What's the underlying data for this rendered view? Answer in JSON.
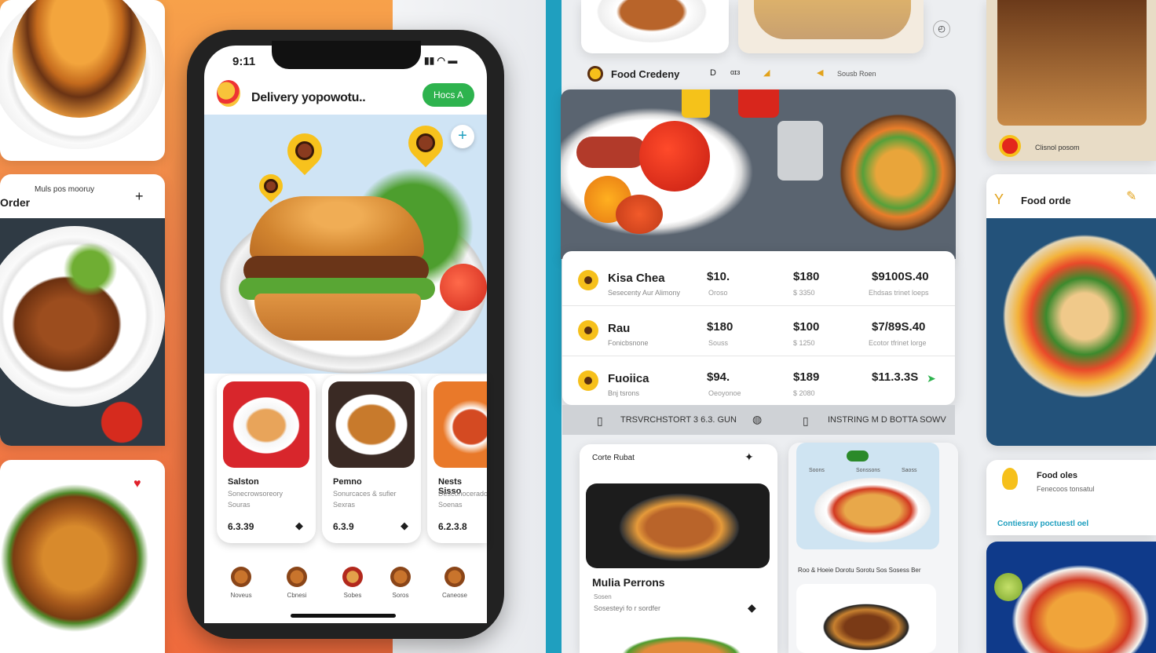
{
  "phone": {
    "status_time": "9:11",
    "app_title": "Delivery yopowotu..",
    "action_button": "Hocs A",
    "menu_cards": [
      {
        "title": "Salston",
        "line1": "Sonecrowsoreory",
        "line2": "Souras",
        "price": "6.3.39"
      },
      {
        "title": "Pemno",
        "line1": "Sonurcaces & sufier",
        "line2": "Sexras",
        "price": "6.3.9"
      },
      {
        "title": "Nests Sisso",
        "line1": "Desconocerado",
        "line2": "Soenas",
        "price": "6.2.3.8"
      }
    ],
    "tabs": [
      "Noveus",
      "Cbnesi",
      "Sobes",
      "Soros",
      "Caneose"
    ]
  },
  "left_cards": {
    "order_heading": "Order",
    "order_sub": "Muls pos mooruy"
  },
  "right_panel": {
    "header": {
      "brand": "Food Credeny",
      "item2": "D",
      "item3": "ɑɪɜ",
      "item4": "Sousb Roen"
    },
    "rows": [
      {
        "name": "Kisa Chea",
        "sub": "Sesecenty Aur Alimony",
        "c1": "$10.",
        "c1s": "Oroso",
        "c2": "$180",
        "c2s": "$ 3350",
        "c3": "$9100S.40",
        "c3s": "Ehdsas trinet loeps"
      },
      {
        "name": "Rau",
        "sub": "Fonicbsnone",
        "c1": "$180",
        "c1s": "Souss",
        "c2": "$100",
        "c2s": "$ 1250",
        "c3": "$7/89S.40",
        "c3s": "Ecotor tfrinet lorge"
      },
      {
        "name": "Fuoiica",
        "sub": "Bnj tsrons",
        "c1": "$94.",
        "c1s": "Oeoyonoe",
        "c2": "$189",
        "c2s": "$ 2080",
        "c3": "$11.3.3S",
        "c3s": ""
      }
    ],
    "footer_left": "TRSVRCHSTORT 3 6.3. GUN",
    "footer_right": "INSTRING M D BOTTA SOWV",
    "card_a_title": "Corte Rubat",
    "card_a_name": "Mulia Perrons",
    "card_a_sub1": "Sosen",
    "card_a_sub2": "Sosesteyi fo r sordfer",
    "card_b_labels": [
      "Soons",
      "Sonssons",
      "Saoss"
    ],
    "card_b_caption": "Roo & Hoeie Dorotu Sorotu Sos Sosess Ber",
    "food_orde": "Food orde",
    "food_oies": "Food oles",
    "food_oies_sub": "Fenecoos tonsatul",
    "teal_line": "Contiesray poctuestl oel",
    "clasf": "Clisnol posom"
  },
  "colors": {
    "accent_green": "#2eb34e",
    "accent_teal": "#1f9fbf",
    "pin_yellow": "#f7c21d",
    "orange_bg": "#f0824a"
  }
}
